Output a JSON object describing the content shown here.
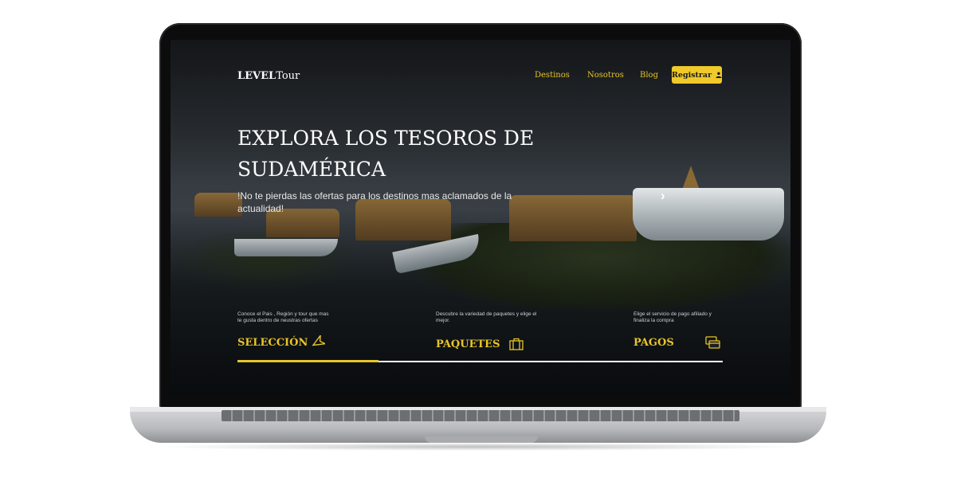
{
  "site": {
    "logo_bold": "LEVEL",
    "logo_rest": "Tour"
  },
  "nav": {
    "items": [
      "Destinos",
      "Nosotros",
      "Blog"
    ],
    "register_label": "Registrar",
    "register_icon": "user-icon"
  },
  "hero": {
    "title": "EXPLORA LOS TESOROS DE SUDAMÉRICA",
    "subtitle": "!No te pierdas las ofertas para los destinos mas aclamados de la actualidad!",
    "next_icon": "chevron-right-icon"
  },
  "steps": [
    {
      "description": "Conoce el Pais , Región y tour que mas te gusta dentro de neustras ofertas",
      "title": "SELECCIÓN",
      "icon": "airplane-icon"
    },
    {
      "description": "Descubre la variedad de paquetes y elige el mejor.",
      "title": "PAQUETES",
      "icon": "briefcase-icon"
    },
    {
      "description": "Elige el servicio de pago afiliado y finaliza la compra",
      "title": "PAGOS",
      "icon": "credit-card-icon"
    }
  ],
  "progress": {
    "fraction": 0.29
  },
  "colors": {
    "accent": "#e7c52a",
    "button": "#f0c92a"
  }
}
